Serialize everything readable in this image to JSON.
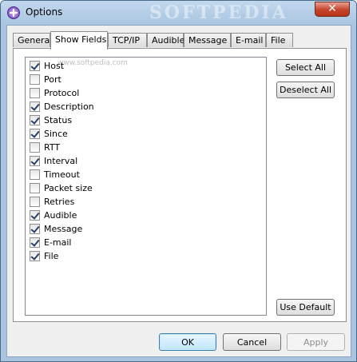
{
  "window": {
    "title": "Options",
    "watermark": "SOFTPEDIA",
    "close_label": "✕"
  },
  "tabs": [
    {
      "label": "General",
      "active": false
    },
    {
      "label": "Show Fields",
      "active": true
    },
    {
      "label": "TCP/IP",
      "active": false
    },
    {
      "label": "Audible",
      "active": false
    },
    {
      "label": "Message",
      "active": false
    },
    {
      "label": "E-mail",
      "active": false
    },
    {
      "label": "File",
      "active": false
    }
  ],
  "list_watermark": "www.softpedia.com",
  "fields": [
    {
      "label": "Host",
      "checked": true
    },
    {
      "label": "Port",
      "checked": false
    },
    {
      "label": "Protocol",
      "checked": false
    },
    {
      "label": "Description",
      "checked": true
    },
    {
      "label": "Status",
      "checked": true
    },
    {
      "label": "Since",
      "checked": true
    },
    {
      "label": "RTT",
      "checked": false
    },
    {
      "label": "Interval",
      "checked": true
    },
    {
      "label": "Timeout",
      "checked": false
    },
    {
      "label": "Packet size",
      "checked": false
    },
    {
      "label": "Retries",
      "checked": false
    },
    {
      "label": "Audible",
      "checked": true
    },
    {
      "label": "Message",
      "checked": true
    },
    {
      "label": "E-mail",
      "checked": true
    },
    {
      "label": "File",
      "checked": true
    }
  ],
  "side_buttons": {
    "select_all": "Select All",
    "deselect_all": "Deselect All",
    "use_default": "Use Default"
  },
  "footer": {
    "ok": "OK",
    "cancel": "Cancel",
    "apply": "Apply"
  }
}
